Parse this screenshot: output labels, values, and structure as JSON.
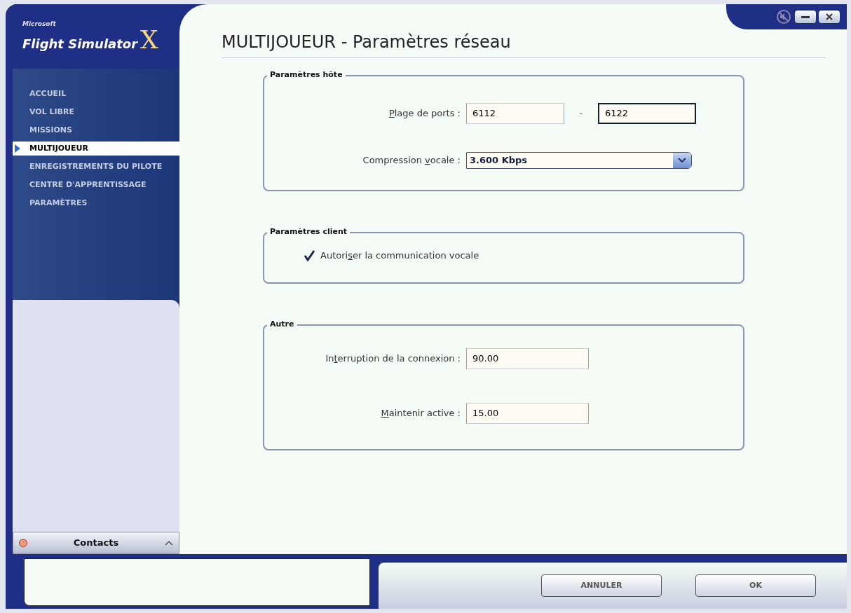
{
  "logo": {
    "maker": "Microsoft",
    "product": "Flight Simulator",
    "mark": "X"
  },
  "window_controls": [
    {
      "kind": "sound",
      "muted": true
    },
    {
      "kind": "minimize"
    },
    {
      "kind": "close"
    }
  ],
  "sidebar": {
    "items": [
      {
        "label": "ACCUEIL",
        "selected": false
      },
      {
        "label": "VOL LIBRE",
        "selected": false
      },
      {
        "label": "MISSIONS",
        "selected": false
      },
      {
        "label": "MULTIJOUEUR",
        "selected": true
      },
      {
        "label": "ENREGISTREMENTS DU PILOTE",
        "selected": false
      },
      {
        "label": "CENTRE D'APPRENTISSAGE",
        "selected": false
      },
      {
        "label": "PARAMÈTRES",
        "selected": false
      }
    ]
  },
  "contacts": {
    "title": "Contacts",
    "online": false,
    "expanded": false
  },
  "page_title": "MULTIJOUEUR - Paramètres réseau",
  "groups": [
    {
      "title": "Paramètres hôte",
      "rows": [
        {
          "kind": "range",
          "label_parts": {
            "key": "P",
            "after": "lage de ports :"
          },
          "separator": "-",
          "fields": [
            {
              "value": "6112",
              "focused": false
            },
            {
              "value": "6122",
              "focused": true
            }
          ]
        },
        {
          "kind": "dropdown",
          "label_parts": {
            "before": "Compression ",
            "key": "v",
            "after": "ocale :"
          },
          "value": "3.600 Kbps"
        }
      ]
    },
    {
      "title": "Paramètres client",
      "rows": [
        {
          "kind": "checkbox",
          "label_parts": {
            "before": "Autori",
            "key": "s",
            "after": "er la communication vocale"
          },
          "checked": true
        }
      ]
    },
    {
      "title": "Autre",
      "rows": [
        {
          "kind": "field",
          "label_parts": {
            "before": "In",
            "key": "t",
            "after": "erruption de la connexion :"
          },
          "value": "90.00"
        },
        {
          "kind": "field",
          "label_parts": {
            "key": "M",
            "after": "aintenir active :"
          },
          "value": "15.00"
        }
      ]
    }
  ],
  "buttons": [
    "ANNULER",
    "OK"
  ]
}
